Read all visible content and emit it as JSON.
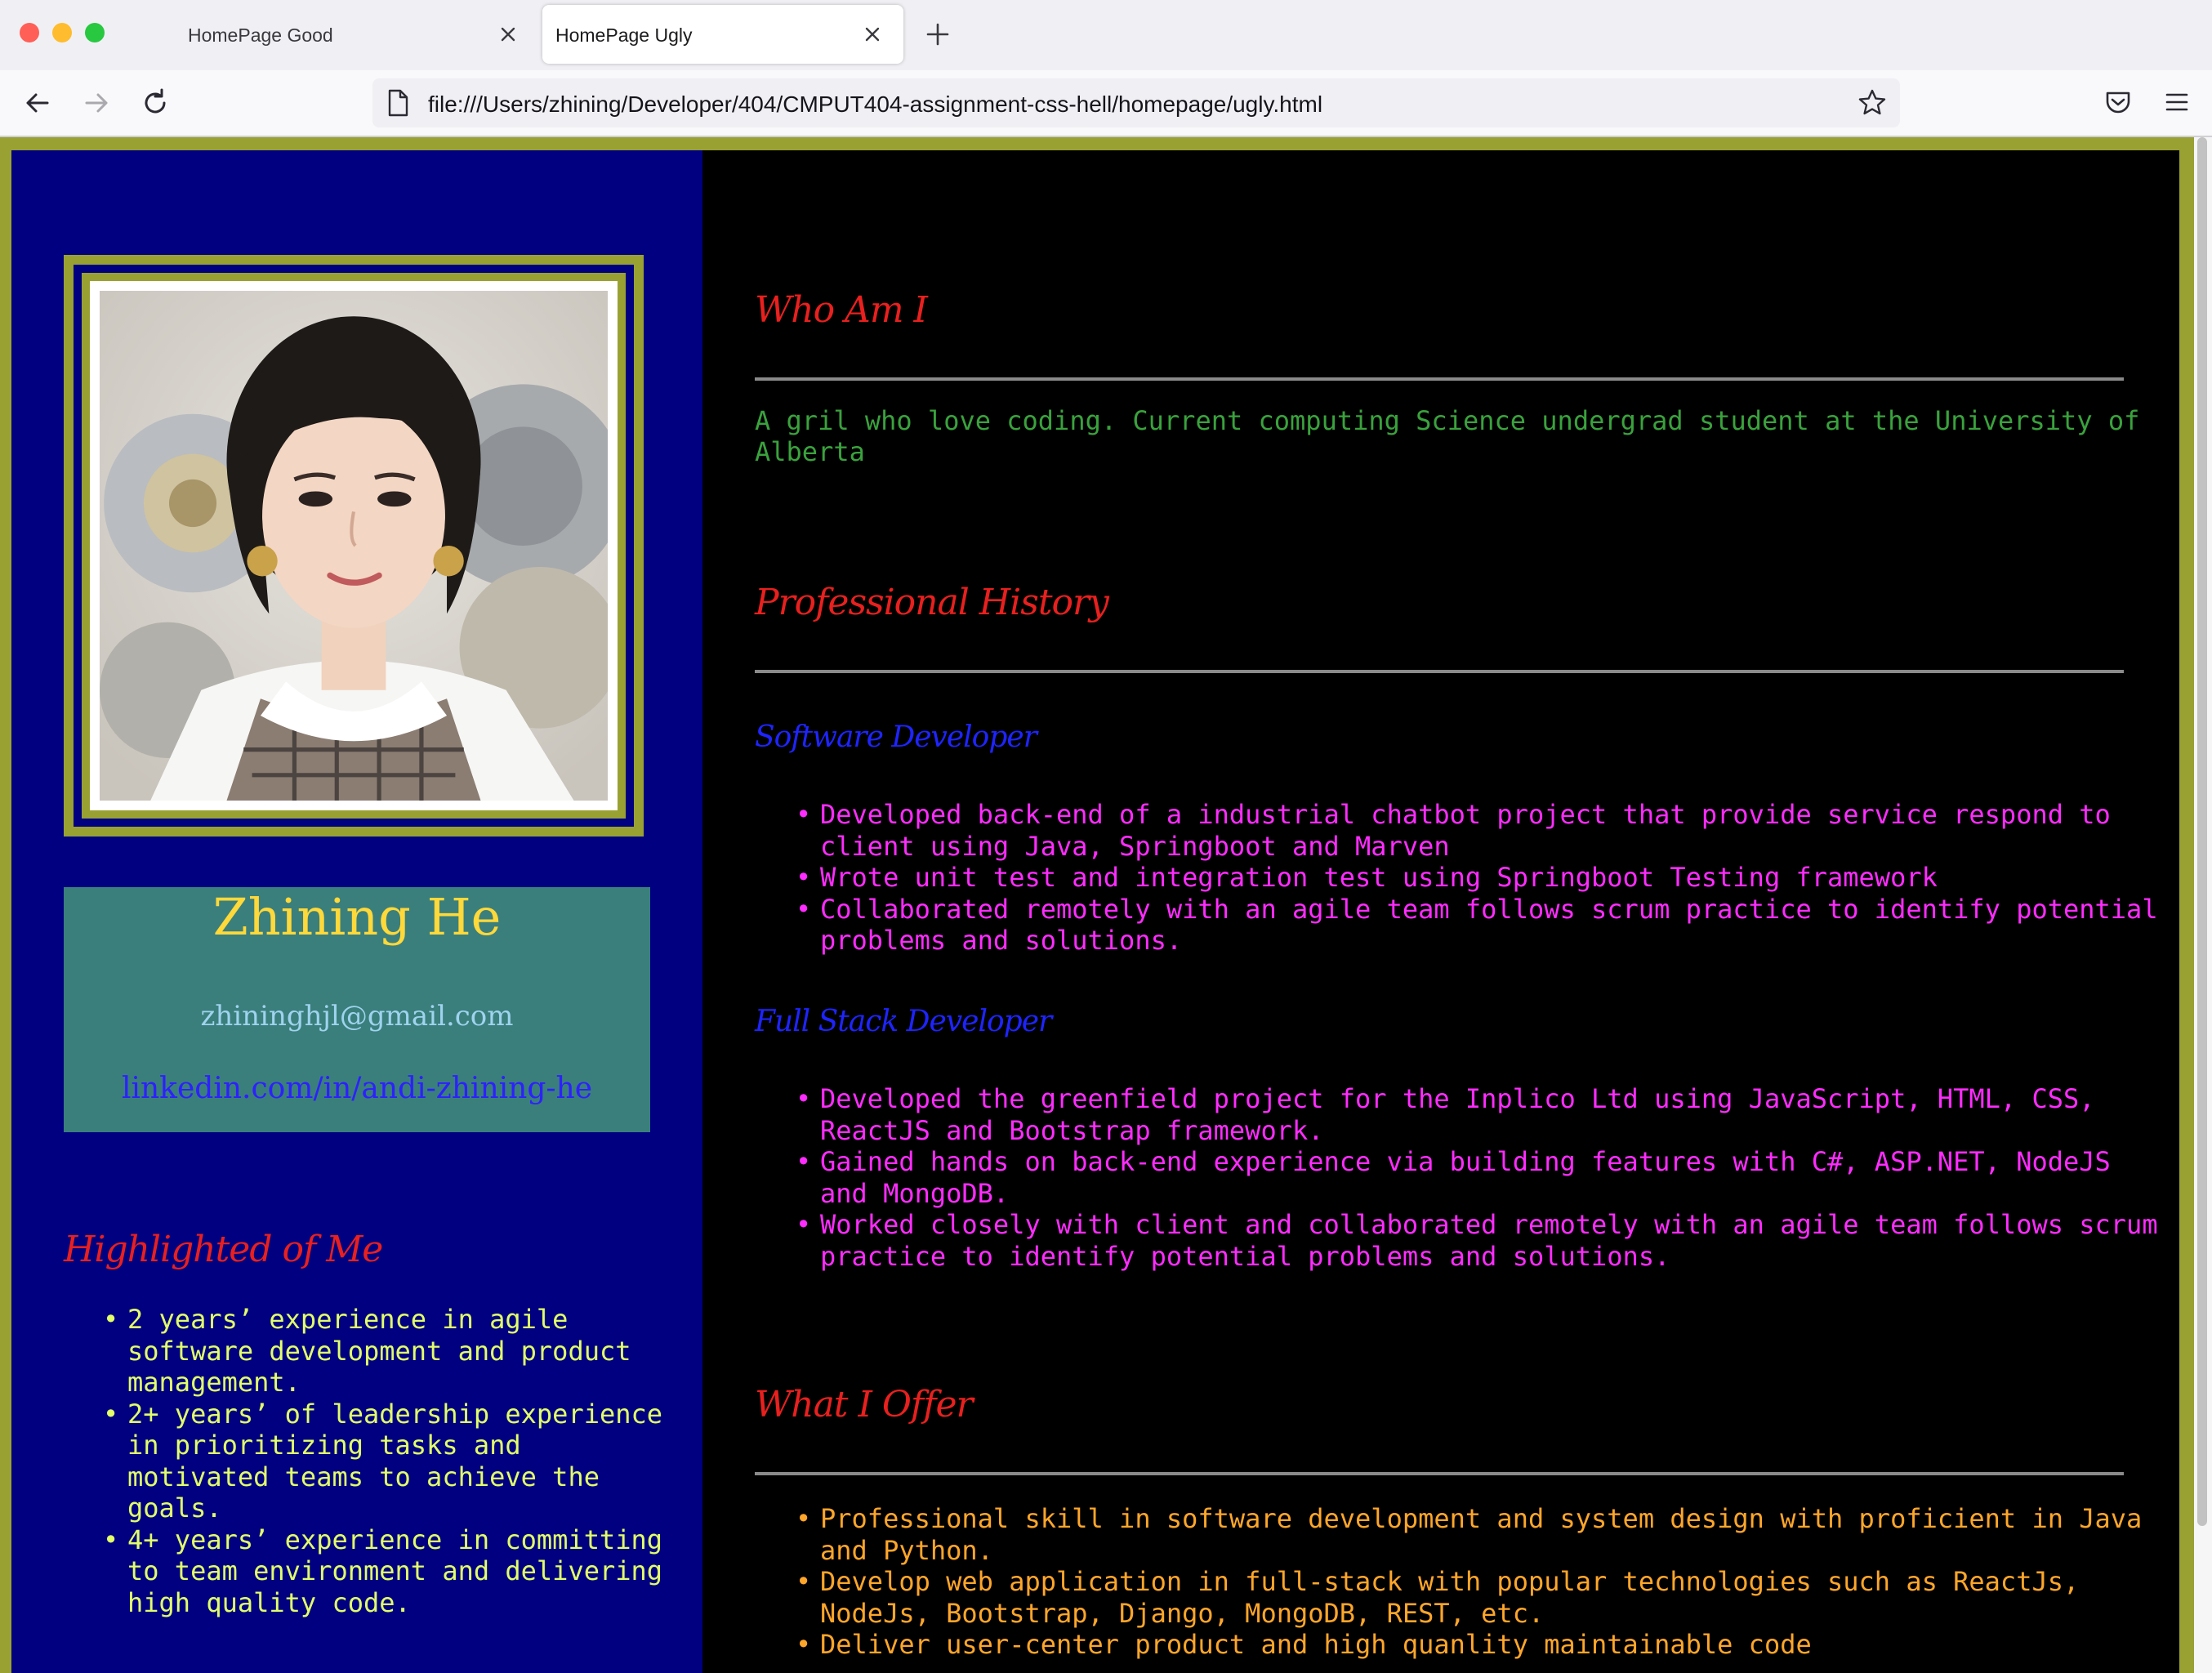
{
  "browser": {
    "tabs": [
      {
        "title": "HomePage Good",
        "active": false
      },
      {
        "title": "HomePage Ugly",
        "active": true
      }
    ],
    "url": "file:///Users/zhining/Developer/404/CMPUT404-assignment-css-hell/homepage/ugly.html",
    "icons": {
      "back": "back-arrow-icon",
      "forward": "forward-arrow-icon",
      "reload": "reload-icon",
      "page": "page-icon",
      "bookmark": "star-icon",
      "pocket": "pocket-icon",
      "menu": "hamburger-menu-icon",
      "new_tab": "plus-icon",
      "close_tab": "close-icon"
    },
    "traffic_lights": {
      "close": "#ff5f57",
      "minimize": "#febc2e",
      "zoom": "#28c840"
    }
  },
  "page": {
    "colors": {
      "border": "#99a133",
      "sidebar_bg": "#000080",
      "main_bg": "#000000",
      "card_bg": "#3a7f7c",
      "heading": "#e8201e",
      "job_title": "#1e24ff",
      "about_text": "#3aa23d",
      "job_text": "#ff2cff",
      "highlight_text": "#e2ff6a",
      "offer_text": "#ffa62a"
    },
    "profile": {
      "name": "Zhining He",
      "email": "zhininghjl@gmail.com",
      "linkedin": "linkedin.com/in/andi-zhining-he"
    },
    "highlights": {
      "heading": "Highlighted of Me",
      "items": [
        "2 years’ experience in agile software development and product management.",
        "2+ years’ of leadership experience in prioritizing tasks and motivated teams to achieve the goals.",
        "4+ years’ experience in committing to team environment and delivering high quality code."
      ]
    },
    "who_am_i": {
      "heading": "Who Am I",
      "text": "A gril who love coding. Current computing Science undergrad student at the University of Alberta"
    },
    "history": {
      "heading": "Professional History",
      "jobs": [
        {
          "title": "Software Developer",
          "items": [
            "Developed back-end of a industrial chatbot project that provide service respond to client using Java, Springboot and Marven",
            "Wrote unit test and integration test using Springboot Testing framework",
            "Collaborated remotely with an agile team follows scrum practice to identify potential problems and solutions."
          ]
        },
        {
          "title": "Full Stack Developer",
          "items": [
            "Developed the greenfield project for the Inplico Ltd using JavaScript, HTML, CSS, ReactJS and Bootstrap framework.",
            "Gained hands on back-end experience via building features with C#, ASP.NET, NodeJS and MongoDB.",
            "Worked closely with client and collaborated remotely with an agile team follows scrum practice to identify potential problems and solutions."
          ]
        }
      ]
    },
    "offer": {
      "heading": "What I Offer",
      "items": [
        "Professional skill in software development and system design with proficient in Java and Python.",
        "Develop web application in full-stack with popular technologies such as ReactJs, NodeJs, Bootstrap, Django, MongoDB, REST, etc.",
        "Deliver user-center product and high quanlity maintainable code"
      ]
    }
  }
}
